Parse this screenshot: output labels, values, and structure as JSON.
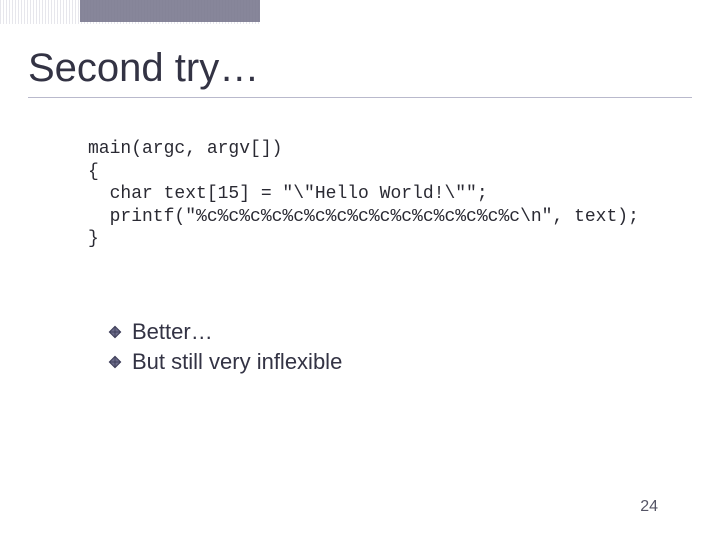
{
  "title": "Second try…",
  "code": {
    "l1": "main(argc, argv[])",
    "l2": "{",
    "l3": "  char text[15] = \"\\\"Hello World!\\\"\";",
    "l4": "  printf(\"%c%c%c%c%c%c%c%c%c%c%c%c%c%c%c\\n\", text);",
    "l5": "}"
  },
  "bullets": [
    "Better…",
    "But still very inflexible"
  ],
  "page_number": "24"
}
